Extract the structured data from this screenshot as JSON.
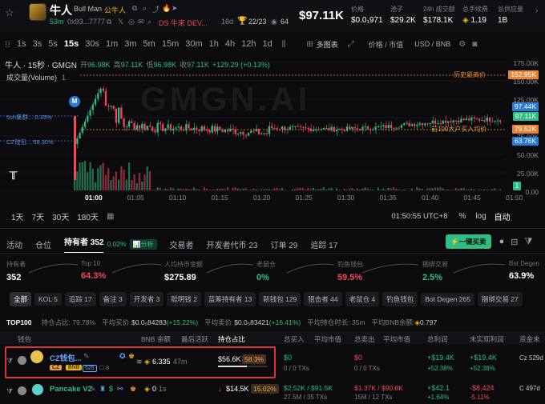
{
  "header": {
    "name": "牛人",
    "full_name": "Bull Man",
    "cn_name": "公牛人",
    "age": "53m",
    "address": "0x93...7777",
    "ds": "DS 牛来 DEV...",
    "dev_age": "18d",
    "holders_ratio": "22/23",
    "views": "64",
    "price_big": "$97.11K",
    "stats": [
      {
        "label": "价格",
        "value": "$0.0₁971"
      },
      {
        "label": "池子",
        "value": "$29.2K"
      },
      {
        "label": "24h 成交额",
        "value": "$178.1K"
      },
      {
        "label": "总手续费",
        "value": "1.19"
      },
      {
        "label": "总供应量",
        "value": "1B"
      }
    ]
  },
  "toolbar": {
    "timeframes": [
      "1s",
      "3s",
      "5s",
      "15s",
      "30s",
      "1m",
      "3m",
      "5m",
      "15m",
      "30m",
      "1h",
      "4h",
      "12h",
      "1d"
    ],
    "active_timeframe": "15s",
    "multi_chart": "多图表",
    "price_mcap": "价格 / 市值",
    "currency": "USD / BNB"
  },
  "chart": {
    "title": "牛人 · 15秒 · GMGN",
    "ohlc": {
      "o_label": "开",
      "o": "96.98K",
      "h_label": "高",
      "h": "97.11K",
      "l_label": "低",
      "l": "96.98K",
      "c_label": "收",
      "c": "97.11K",
      "chg": "+129.29 (+0.13%)"
    },
    "volume_label": "成交量(Volume)",
    "volume_val": "1",
    "watermark": "GMGN.AI",
    "ath_label": "历史最高价",
    "avg_label": "前100大户买入均价",
    "sniper_label": "5sh集群... 0.35%",
    "cz_label": "CZ钱包... 58.30%",
    "y_ticks": [
      "175.00K",
      "150.00K",
      "125.00K",
      "100.00K",
      "75.00K",
      "50.00K",
      "25.00K",
      "0.00"
    ],
    "price_tags": [
      {
        "text": "152.95K",
        "color": "#e5853a"
      },
      {
        "text": "97.44K",
        "color": "#2a7bd4"
      },
      {
        "text": "97.11K",
        "color": "#2ebd85"
      },
      {
        "text": "79.52K",
        "color": "#e5853a"
      },
      {
        "text": "63.76K",
        "color": "#2a7bd4"
      },
      {
        "text": "1",
        "color": "#2ebd85"
      }
    ],
    "x_ticks": [
      "01:00",
      "01:05",
      "01:10",
      "01:15",
      "01:20",
      "01:25",
      "01:30",
      "01:35",
      "01:40",
      "01:45",
      "01:50"
    ],
    "ranges": [
      "1天",
      "7天",
      "30天",
      "180天"
    ],
    "clock": "01:50:55 UTC+8",
    "pct": "%",
    "log": "log",
    "auto": "自动"
  },
  "tabs": {
    "items": [
      "活动",
      "仓位",
      "持有者 352",
      "开发者",
      "开发者代币 23",
      "订单 29",
      "追踪 17"
    ],
    "holders_pct": "0.02%",
    "analysis": "分析",
    "trade": "交易者",
    "buy_button": "一键买卖"
  },
  "stats_row": [
    {
      "label": "持有者",
      "value": "352",
      "color": "#fff"
    },
    {
      "label": "Top 10",
      "value": "64.3%",
      "color": "#f6465d"
    },
    {
      "label": "人均持币金额",
      "value": "$275.89",
      "color": "#fff"
    },
    {
      "label": "老鼠仓",
      "value": "0%",
      "color": "#2ebd85"
    },
    {
      "label": "钓鱼钱包",
      "value": "59.5%",
      "color": "#f6465d"
    },
    {
      "label": "捆绑交易",
      "value": "2.5%",
      "color": "#2ebd85"
    },
    {
      "label": "Bot Degen",
      "value": "63.9%",
      "color": "#fff"
    }
  ],
  "filters": [
    "全部",
    "KOL 5",
    "追踪 17",
    "备注 3",
    "开发者 3",
    "聪明钱 2",
    "蓝筹持有者 13",
    "新钱包 129",
    "狙击者 44",
    "老鼠仓 4",
    "钓鱼钱包",
    "Bot Degen 265",
    "捆绑交易 27"
  ],
  "top100": {
    "label": "TOP100",
    "hold": "持仓占比: 79.78%",
    "avg_buy_label": "平均买价",
    "avg_buy": "$0.0₅84283",
    "avg_buy_pct": "(+15.22%)",
    "avg_sell_label": "平均卖价",
    "avg_sell": "$0.0₅83421",
    "avg_sell_pct": "(+16.41%)",
    "avg_time": "平均持仓时长: 35m",
    "bnb_avg": "平均BNB余额: ",
    "bnb_val": "0.797"
  },
  "table": {
    "headers": [
      "钱包",
      "BNB 余额",
      "最后活跃",
      "持仓占比",
      "总买入",
      "平均市值",
      "总卖出",
      "平均市值",
      "总利润",
      "未实现利润",
      "资金来"
    ],
    "rows": [
      {
        "name": "CZ钱包...",
        "tags": [
          "CZ",
          "BNB",
          "525"
        ],
        "bnb": "6.335",
        "last": "47m",
        "hold_val": "$56.6K",
        "hold_pct": "58.3%",
        "buy": "$0",
        "buy_sub": "0 / 0 TXs",
        "sell": "$0",
        "sell_sub": "0 / 0 TXs",
        "profit": "+$19.4K",
        "profit_pct": "+52.38%",
        "unreal": "+$19.4K",
        "unreal_pct": "+52.38%",
        "src": "Cz 529d"
      },
      {
        "name": "Pancake V2",
        "tags": [],
        "bnb": "0",
        "last": "1s",
        "hold_val": "$14.5K",
        "hold_pct": "15.02%",
        "buy": "$2.52K / $91.5K",
        "buy_sub": "27.5M / 35 TXs",
        "sell": "$1.37K / $90.8K",
        "sell_sub": "15M / 12 TXs",
        "profit": "+$42.1",
        "profit_pct": "+1.64%",
        "unreal": "-$8,424",
        "unreal_pct": "-5.11%",
        "src": "C 497d"
      }
    ]
  }
}
